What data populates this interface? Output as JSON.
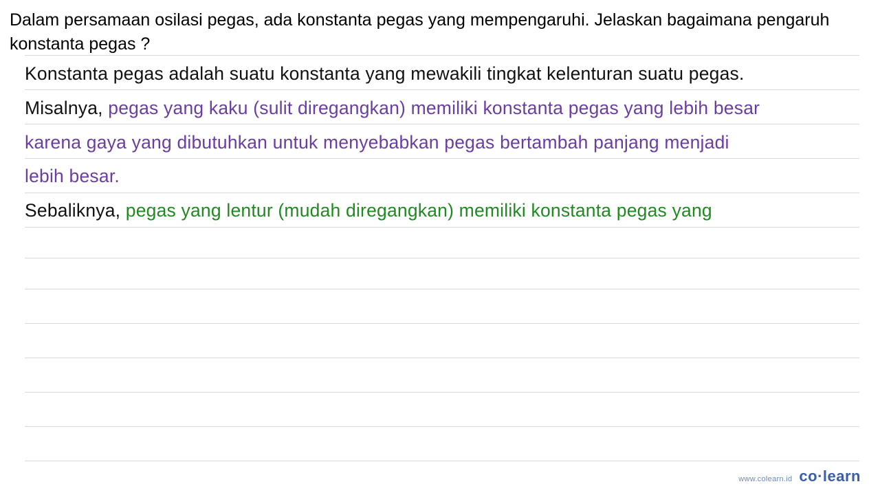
{
  "question": "Dalam persamaan osilasi pegas, ada konstanta pegas yang mempengaruhi. Jelaskan bagaimana pengaruh konstanta pegas ?",
  "answer": {
    "line1_black": "Konstanta pegas adalah suatu konstanta yang mewakili tingkat kelenturan suatu pegas.",
    "line2_black": "Misalnya, ",
    "line2_purple": "pegas yang kaku (sulit diregangkan) memiliki konstanta pegas yang lebih besar",
    "line3_purple": "karena gaya yang dibutuhkan untuk menyebabkan pegas bertambah panjang menjadi",
    "line4_purple": "lebih besar.",
    "line5_black": "Sebaliknya, ",
    "line5_green": "pegas yang lentur (mudah diregangkan) memiliki konstanta pegas yang"
  },
  "branding": {
    "url": "www.colearn.id",
    "logo_co": "co",
    "logo_dot": "·",
    "logo_learn": "learn"
  }
}
